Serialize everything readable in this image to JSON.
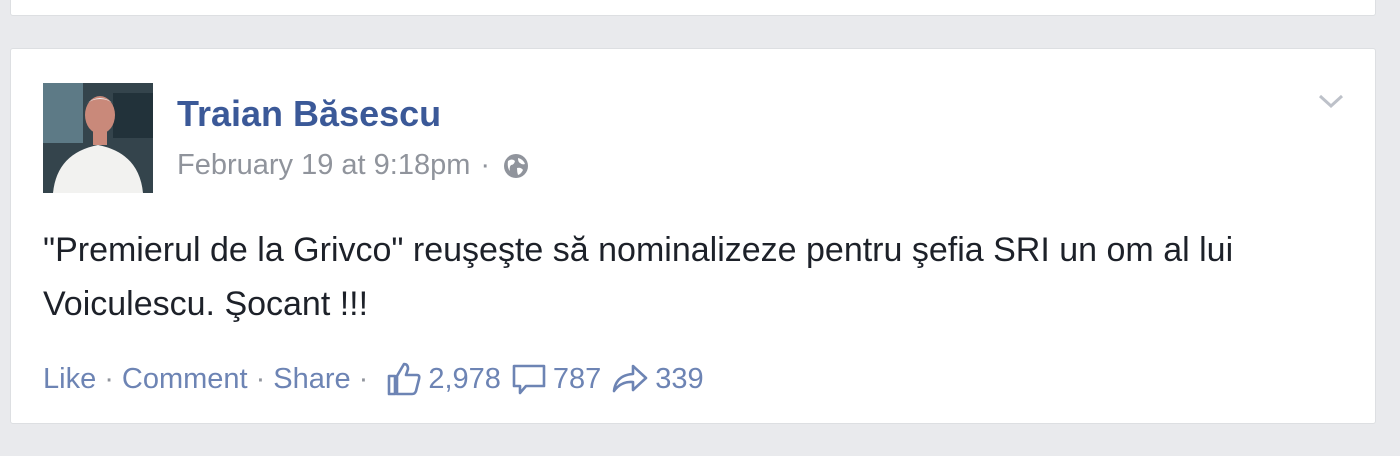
{
  "post": {
    "author": "Traian Băsescu",
    "timestamp": "February 19 at 9:18pm",
    "dot": "·",
    "text": "\"Premierul de la Grivco\" reuşeşte să nominalizeze pentru şefia SRI un om al lui Voiculescu. Şocant !!!",
    "privacy_icon": "globe-icon",
    "menu_icon": "chevron-down-icon"
  },
  "actions": {
    "like": "Like",
    "comment": "Comment",
    "share": "Share",
    "sep": "·"
  },
  "stats": {
    "likes": "2,978",
    "comments": "787",
    "shares": "339"
  },
  "colors": {
    "link": "#3b5998",
    "action": "#6d84b4",
    "meta": "#90949c",
    "text": "#1d2129",
    "background": "#e9eaed"
  }
}
